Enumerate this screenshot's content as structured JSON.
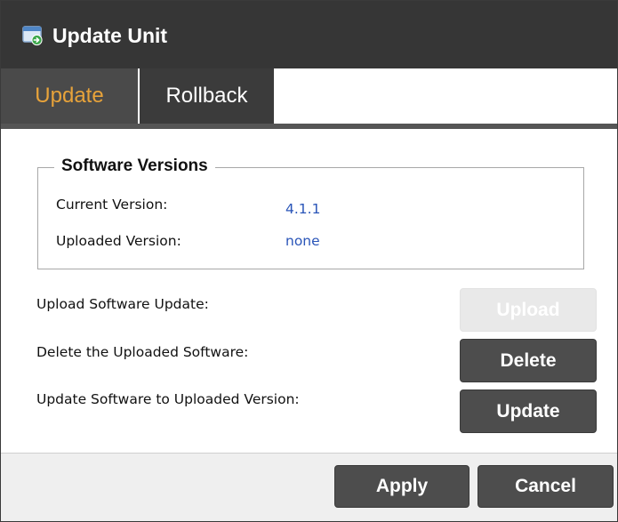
{
  "window": {
    "title": "Update Unit",
    "icon": "update-unit-icon"
  },
  "tabs": [
    {
      "label": "Update",
      "active": true
    },
    {
      "label": "Rollback",
      "active": false
    }
  ],
  "software_versions": {
    "legend": "Software Versions",
    "rows": [
      {
        "label": "Current Version:",
        "value": "4.1.1"
      },
      {
        "label": "Uploaded Version:",
        "value": "none"
      }
    ]
  },
  "actions": [
    {
      "label": "Upload Software Update:",
      "button": "Upload",
      "enabled": false
    },
    {
      "label": "Delete the Uploaded Software:",
      "button": "Delete",
      "enabled": true
    },
    {
      "label": "Update Software to Uploaded Version:",
      "button": "Update",
      "enabled": true
    }
  ],
  "footer": {
    "apply_label": "Apply",
    "cancel_label": "Cancel"
  },
  "colors": {
    "titlebar": "#363636",
    "active_tab_text": "#e8a33a",
    "value_text": "#2a55b8",
    "button": "#4d4d4d",
    "button_disabled": "#e9e9e9"
  }
}
